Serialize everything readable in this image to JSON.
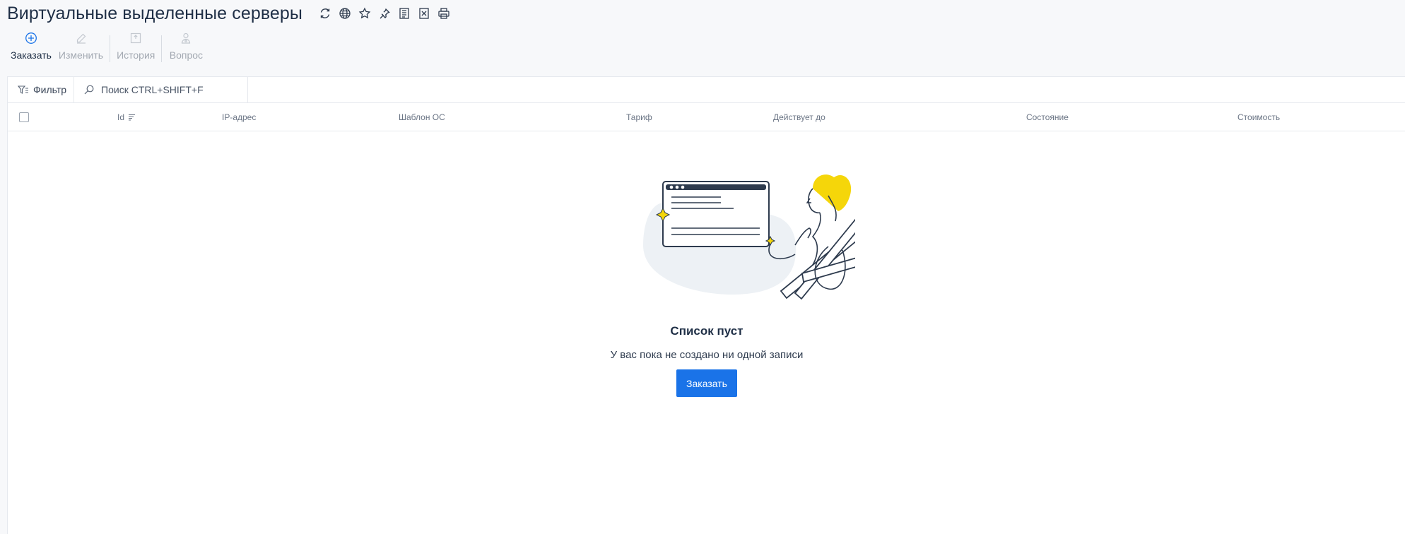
{
  "page": {
    "title": "Виртуальные выделенные серверы",
    "title_tools": [
      "refresh-icon",
      "globe-icon",
      "star-icon",
      "pin-icon",
      "report-icon",
      "export-excel-icon",
      "print-icon"
    ]
  },
  "toolbar": {
    "order_label": "Заказать",
    "edit_label": "Изменить",
    "history_label": "История",
    "question_label": "Вопрос"
  },
  "filter": {
    "label": "Фильтр",
    "search_placeholder": "Поиск CTRL+SHIFT+F"
  },
  "table": {
    "columns": [
      "Id",
      "IP-адрес",
      "Шаблон ОС",
      "Тариф",
      "Действует до",
      "Состояние",
      "Стоимость"
    ]
  },
  "empty_state": {
    "title": "Список пуст",
    "subtitle": "У вас пока не создано ни одной записи",
    "button_label": "Заказать"
  },
  "colors": {
    "accent": "#1a73e8",
    "text": "#1f2f46",
    "illustration_yellow": "#f5d60a",
    "illustration_blob": "#edf1f5"
  }
}
